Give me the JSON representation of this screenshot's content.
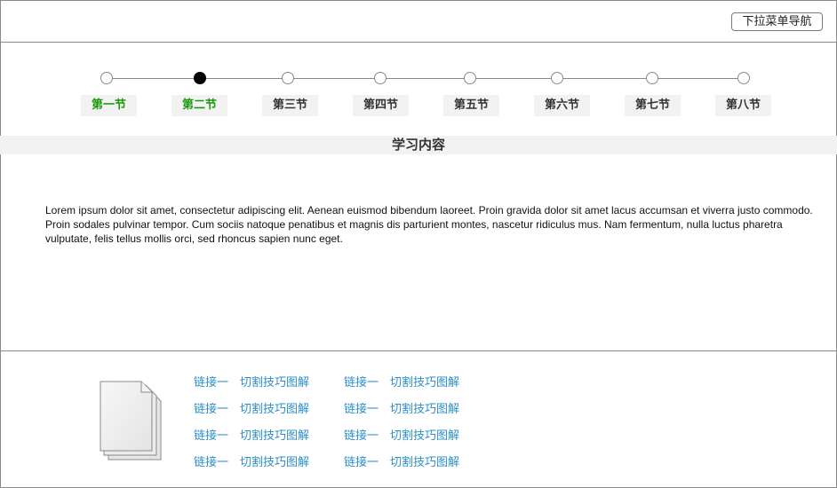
{
  "header": {
    "nav_button": "下拉菜单导航"
  },
  "steps": [
    {
      "label": "第一节",
      "active": false,
      "highlight": true
    },
    {
      "label": "第二节",
      "active": true,
      "highlight": true
    },
    {
      "label": "第三节",
      "active": false,
      "highlight": false
    },
    {
      "label": "第四节",
      "active": false,
      "highlight": false
    },
    {
      "label": "第五节",
      "active": false,
      "highlight": false
    },
    {
      "label": "第六节",
      "active": false,
      "highlight": false
    },
    {
      "label": "第七节",
      "active": false,
      "highlight": false
    },
    {
      "label": "第八节",
      "active": false,
      "highlight": false
    }
  ],
  "section": {
    "title": "学习内容",
    "body": "Lorem ipsum dolor sit amet, consectetur adipiscing elit. Aenean euismod bibendum laoreet. Proin gravida dolor sit amet lacus accumsan et viverra justo commodo. Proin sodales pulvinar tempor. Cum sociis natoque penatibus et magnis dis parturient montes, nascetur ridiculus mus. Nam fermentum, nulla luctus pharetra vulputate, felis tellus mollis orci, sed rhoncus sapien nunc eget."
  },
  "links": {
    "rows": [
      [
        "链接一",
        "切割技巧图解",
        "链接一",
        "切割技巧图解"
      ],
      [
        "链接一",
        "切割技巧图解",
        "链接一",
        "切割技巧图解"
      ],
      [
        "链接一",
        "切割技巧图解",
        "链接一",
        "切割技巧图解"
      ],
      [
        "链接一",
        "切割技巧图解",
        "链接一",
        "切割技巧图解"
      ]
    ]
  },
  "colors": {
    "accent_green": "#1a9a0e",
    "link_blue": "#2e8fc6",
    "active_node": "#000000"
  },
  "icons": {
    "document": "document-stack-icon"
  }
}
